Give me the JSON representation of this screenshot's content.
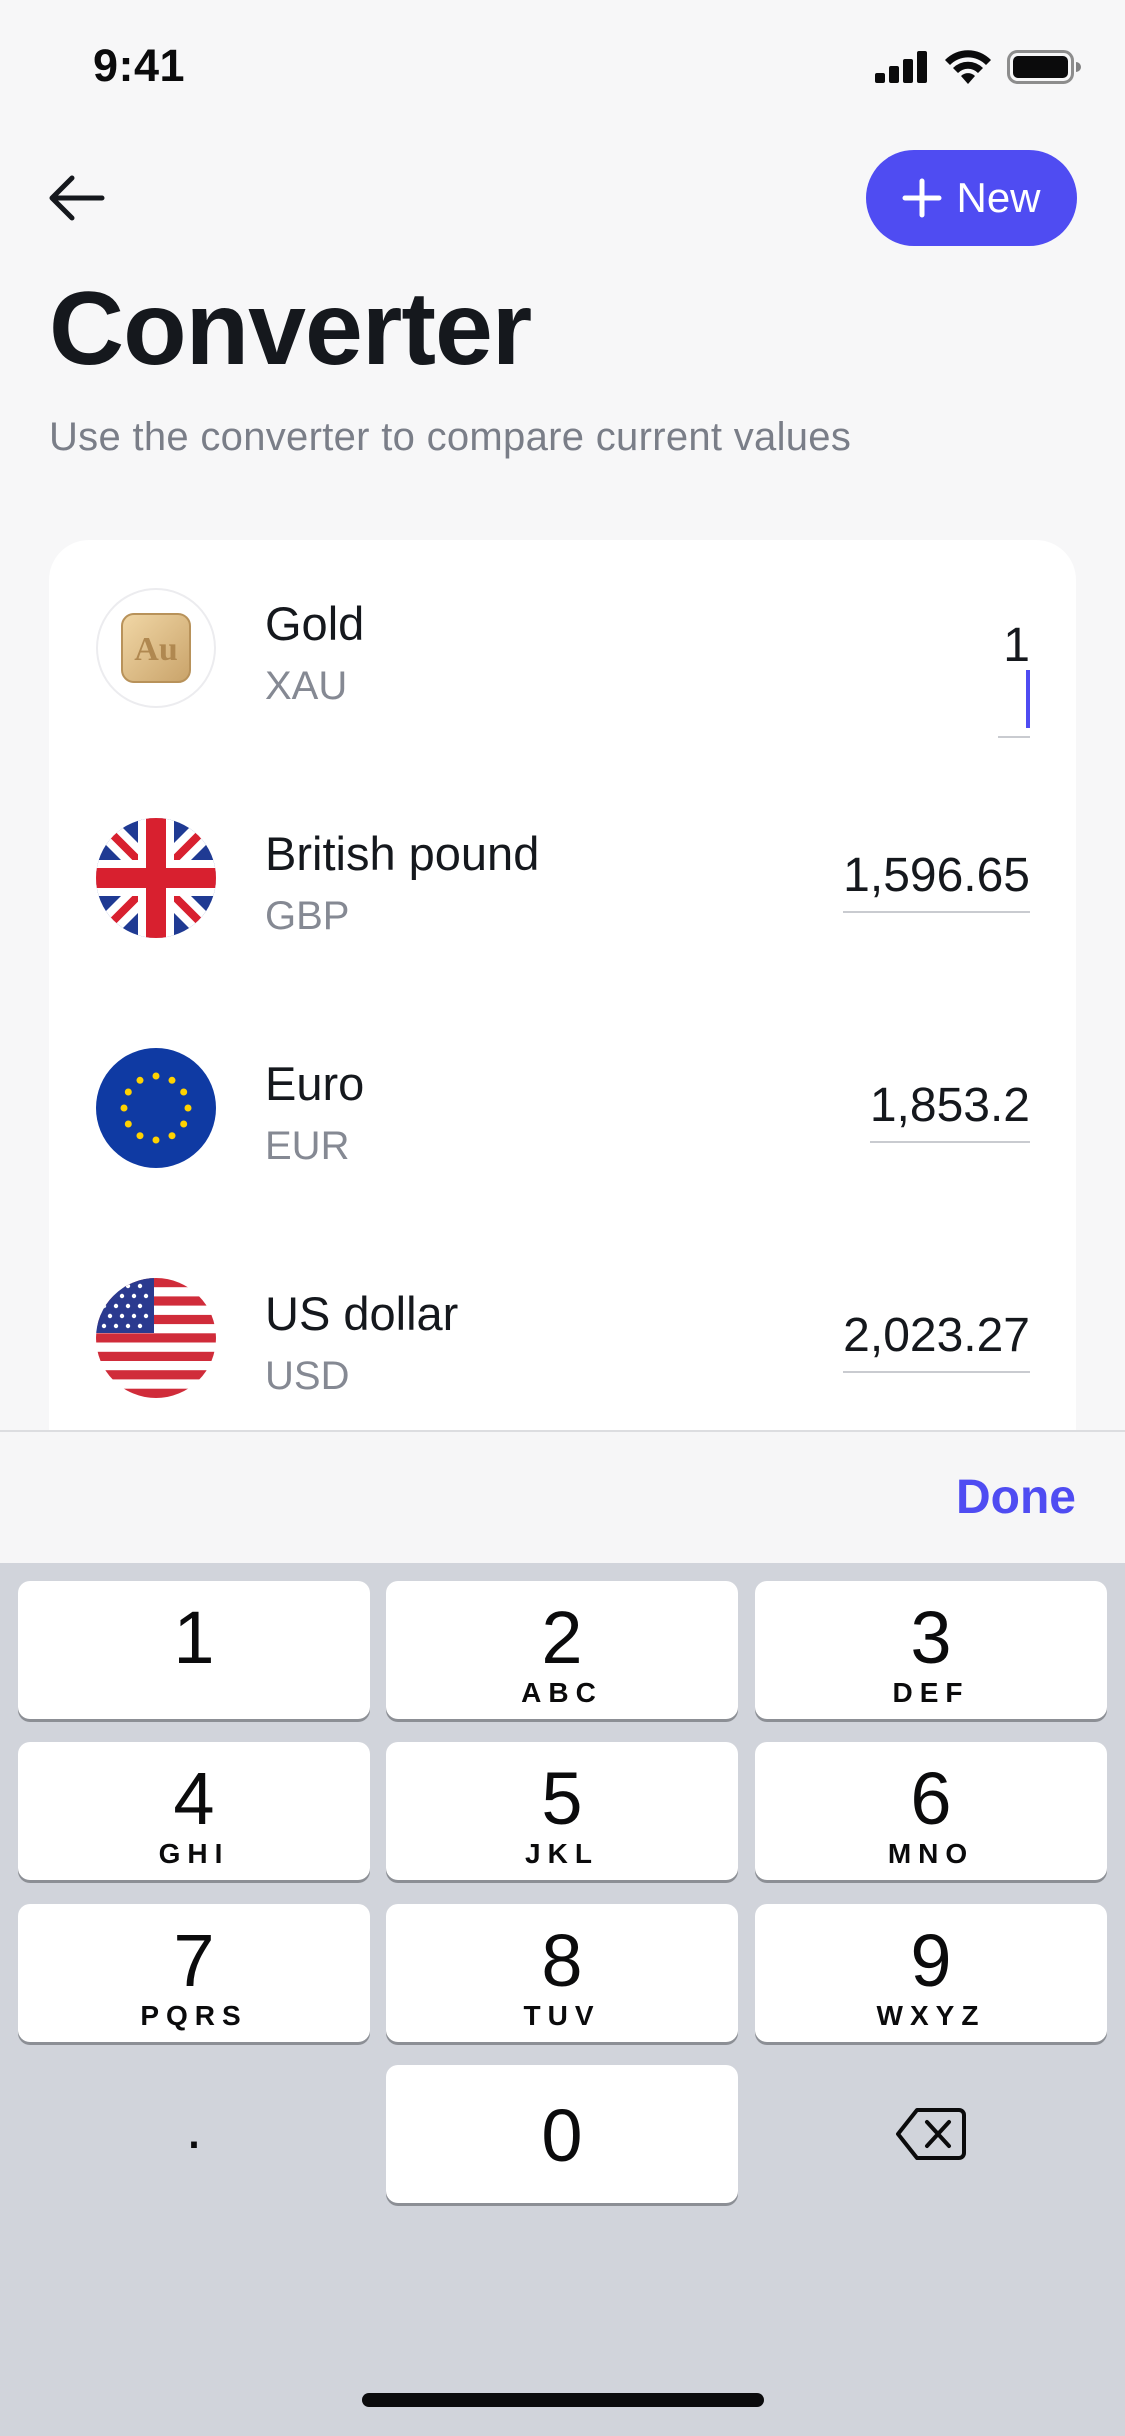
{
  "status_bar": {
    "time": "9:41"
  },
  "header": {
    "new_button_label": "New",
    "title": "Converter",
    "subtitle": "Use the converter to compare current values"
  },
  "currencies": [
    {
      "name": "Gold",
      "code": "XAU",
      "value": "1",
      "icon": "gold-bar-icon",
      "icon_text": "Au",
      "active": true
    },
    {
      "name": "British pound",
      "code": "GBP",
      "value": "1,596.65",
      "icon": "uk-flag-icon"
    },
    {
      "name": "Euro",
      "code": "EUR",
      "value": "1,853.2",
      "icon": "eu-flag-icon"
    },
    {
      "name": "US dollar",
      "code": "USD",
      "value": "2,023.27",
      "icon": "us-flag-icon"
    }
  ],
  "keyboard": {
    "done_label": "Done",
    "keys": [
      {
        "num": "1",
        "letters": ""
      },
      {
        "num": "2",
        "letters": "ABC"
      },
      {
        "num": "3",
        "letters": "DEF"
      },
      {
        "num": "4",
        "letters": "GHI"
      },
      {
        "num": "5",
        "letters": "JKL"
      },
      {
        "num": "6",
        "letters": "MNO"
      },
      {
        "num": "7",
        "letters": "PQRS"
      },
      {
        "num": "8",
        "letters": "TUV"
      },
      {
        "num": "9",
        "letters": "WXYZ"
      },
      {
        "num": "0",
        "letters": ""
      }
    ],
    "decimal": "."
  },
  "colors": {
    "accent": "#4f4cf2",
    "background": "#f7f7f8",
    "keyboard_bg": "#d1d4db"
  }
}
